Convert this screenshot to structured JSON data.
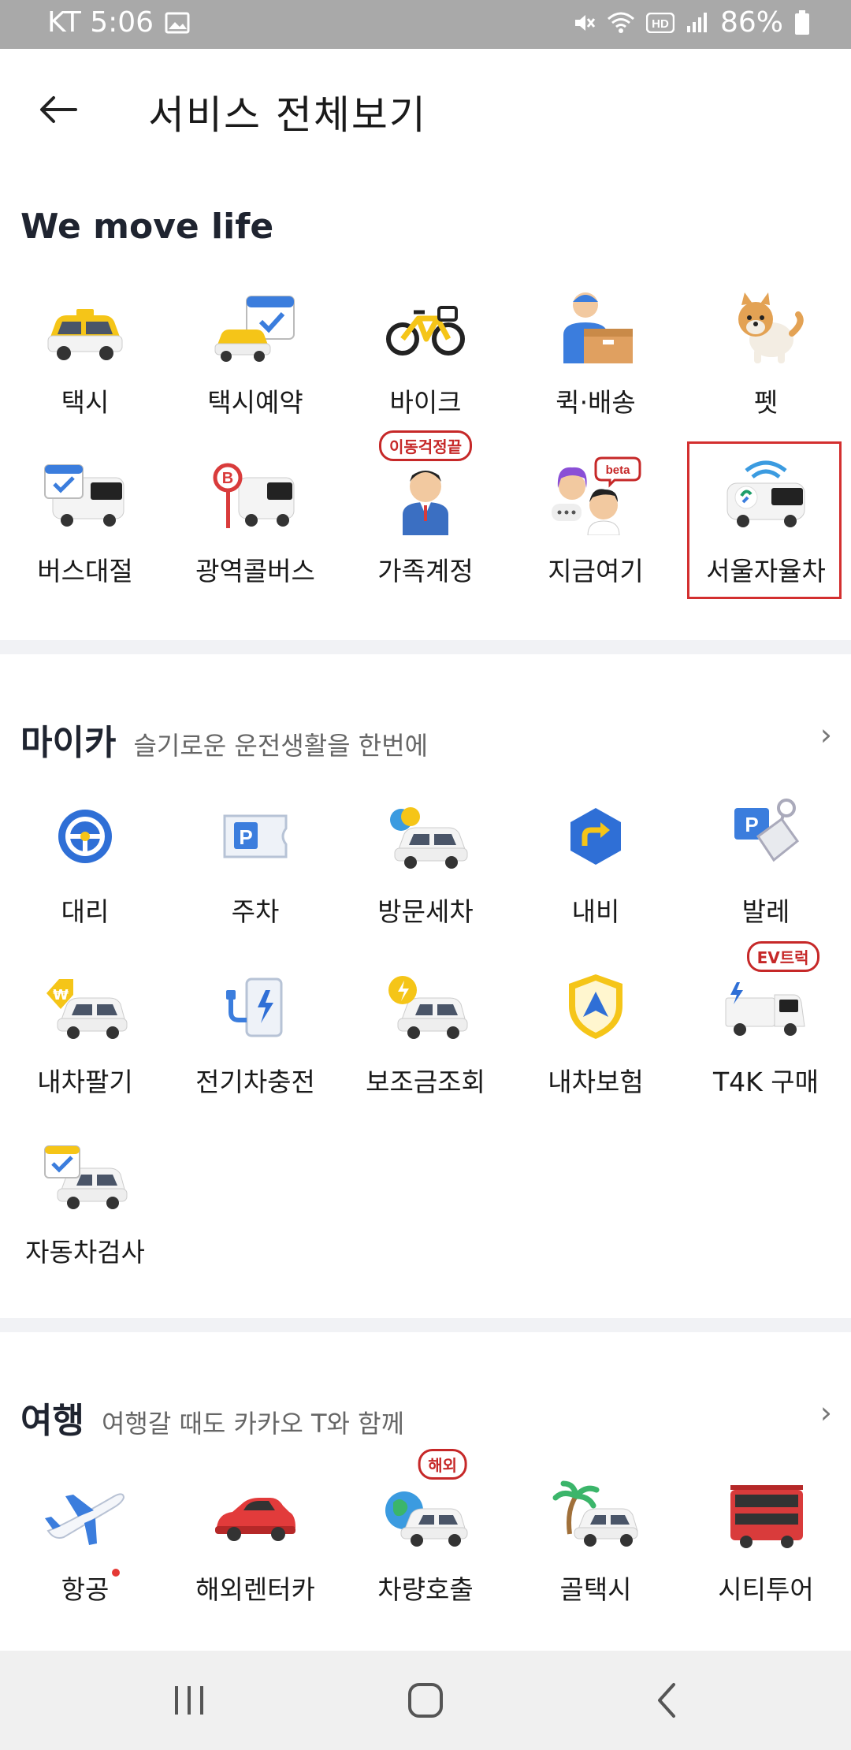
{
  "status_bar": {
    "carrier_time": "KT 5:06",
    "battery": "86%",
    "icons": [
      "gallery-icon",
      "mute-icon",
      "wifi-icon",
      "hd-icon",
      "signal-icon",
      "battery-icon"
    ]
  },
  "header": {
    "title": "서비스 전체보기",
    "back_icon": "back-arrow-icon"
  },
  "sections": {
    "move_life": {
      "title": "We move life",
      "items": [
        {
          "label": "택시",
          "icon": "taxi-icon"
        },
        {
          "label": "택시예약",
          "icon": "taxi-reservation-icon"
        },
        {
          "label": "바이크",
          "icon": "bike-icon"
        },
        {
          "label": "퀵·배송",
          "icon": "delivery-icon"
        },
        {
          "label": "펫",
          "icon": "pet-icon"
        },
        {
          "label": "버스대절",
          "icon": "bus-charter-icon"
        },
        {
          "label": "광역콜버스",
          "icon": "wide-call-bus-icon"
        },
        {
          "label": "가족계정",
          "icon": "family-account-icon",
          "badge": "이동걱정끝"
        },
        {
          "label": "지금여기",
          "icon": "now-here-icon",
          "badge": "beta"
        },
        {
          "label": "서울자율차",
          "icon": "seoul-autonomous-car-icon"
        }
      ]
    },
    "mycar": {
      "title": "마이카",
      "subtitle": "슬기로운 운전생활을 한번에",
      "items": [
        {
          "label": "대리",
          "icon": "designated-driver-icon"
        },
        {
          "label": "주차",
          "icon": "parking-icon"
        },
        {
          "label": "방문세차",
          "icon": "car-wash-icon"
        },
        {
          "label": "내비",
          "icon": "navigation-icon"
        },
        {
          "label": "발레",
          "icon": "valet-icon"
        },
        {
          "label": "내차팔기",
          "icon": "sell-car-icon"
        },
        {
          "label": "전기차충전",
          "icon": "ev-charging-icon"
        },
        {
          "label": "보조금조회",
          "icon": "subsidy-icon"
        },
        {
          "label": "내차보험",
          "icon": "car-insurance-icon"
        },
        {
          "label": "T4K 구매",
          "icon": "ev-truck-icon",
          "badge": "EV트럭"
        },
        {
          "label": "자동차검사",
          "icon": "car-inspection-icon"
        }
      ]
    },
    "travel": {
      "title": "여행",
      "subtitle": "여행갈 때도 카카오 T와 함께",
      "items": [
        {
          "label": "항공",
          "icon": "airplane-icon",
          "dot": true
        },
        {
          "label": "해외렌터카",
          "icon": "rental-car-icon"
        },
        {
          "label": "차량호출",
          "icon": "car-hailing-icon",
          "badge": "해외"
        },
        {
          "label": "골택시",
          "icon": "island-taxi-icon"
        },
        {
          "label": "시티투어",
          "icon": "city-tour-bus-icon"
        }
      ]
    }
  },
  "nav": {
    "recent": "recent-apps-icon",
    "home": "home-icon",
    "back": "nav-back-icon"
  },
  "colors": {
    "status_bar": "#a9a9a9",
    "highlight": "#d32f2f",
    "taxi_yellow": "#f5c518",
    "divider": "#f1f2f5"
  }
}
